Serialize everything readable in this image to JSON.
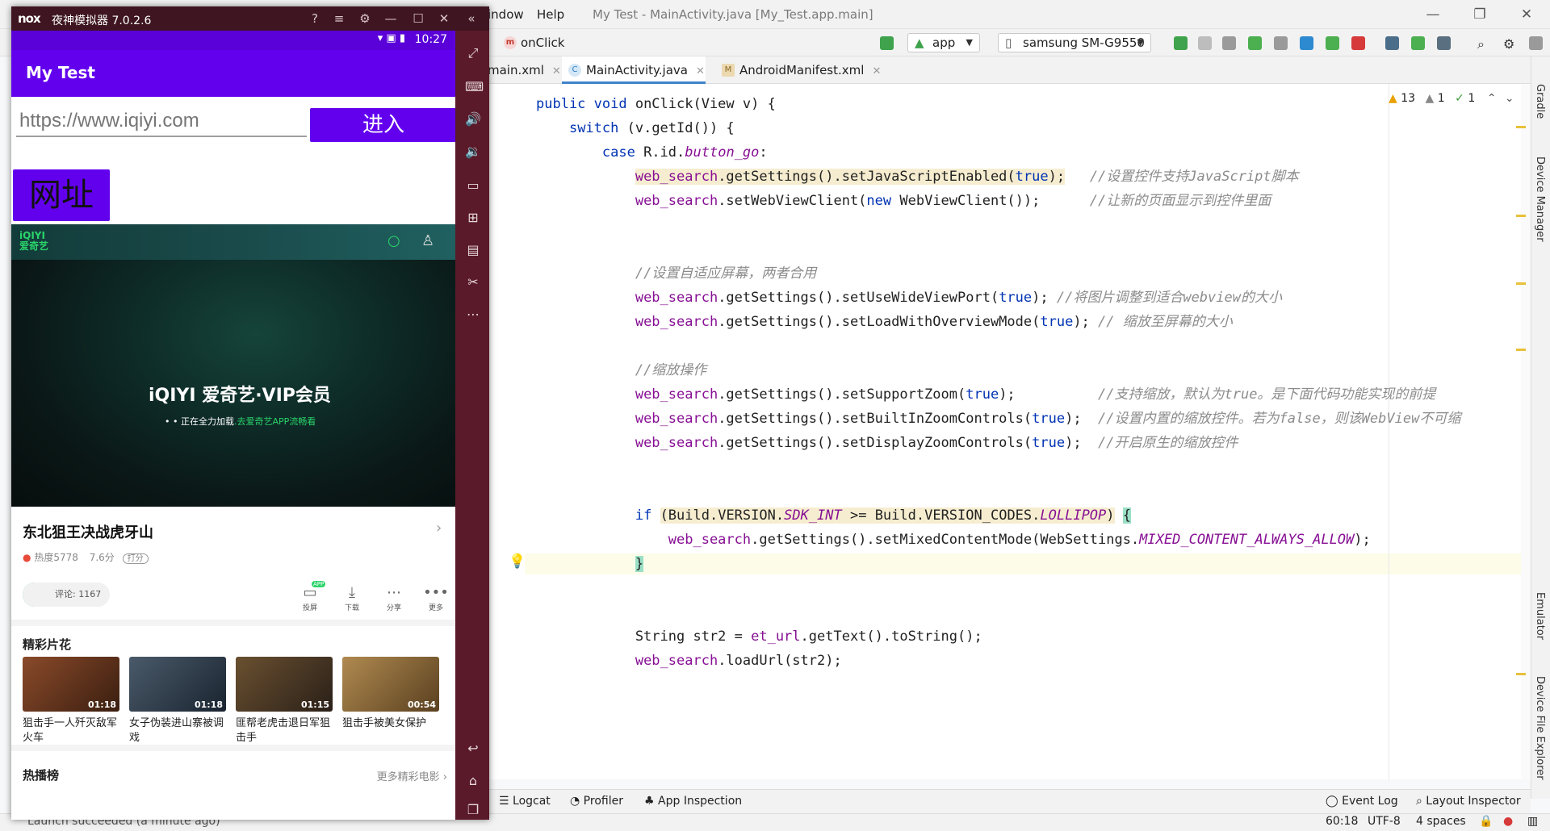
{
  "ide": {
    "menu": [
      "indow",
      "Help"
    ],
    "title": "My Test - MainActivity.java [My_Test.app.main]",
    "breadcrumb": "onClick",
    "breadcrumb_icon": "m",
    "run_config": "app",
    "device": "samsung SM-G9550",
    "tabs": [
      {
        "label": "main.xml",
        "active": false
      },
      {
        "label": "MainActivity.java",
        "active": true
      },
      {
        "label": "AndroidManifest.xml",
        "active": false
      }
    ],
    "inspection": {
      "warnings": "13",
      "weak_warnings": "1",
      "typos": "1"
    },
    "code": [
      "public void onClick(View v) {",
      "    switch (v.getId()) {",
      "        case R.id.button_go:",
      "            web_search.getSettings().setJavaScriptEnabled(true);   //设置控件支持JavaScript脚本",
      "            web_search.setWebViewClient(new WebViewClient());      //让新的页面显示到控件里面",
      "",
      "",
      "            //设置自适应屏幕，两者合用",
      "            web_search.getSettings().setUseWideViewPort(true); //将图片调整到适合webview的大小",
      "            web_search.getSettings().setLoadWithOverviewMode(true); // 缩放至屏幕的大小",
      "",
      "            //缩放操作",
      "            web_search.getSettings().setSupportZoom(true);          //支持缩放，默认为true。是下面代码功能实现的前提",
      "            web_search.getSettings().setBuiltInZoomControls(true);  //设置内置的缩放控件。若为false，则该WebView不可缩",
      "            web_search.getSettings().setDisplayZoomControls(true);  //开启原生的缩放控件",
      "",
      "",
      "            if (Build.VERSION.SDK_INT >= Build.VERSION_CODES.LOLLIPOP) {",
      "                web_search.getSettings().setMixedContentMode(WebSettings.MIXED_CONTENT_ALWAYS_ALLOW);",
      "            }",
      "",
      "",
      "            String str2 = et_url.getText().toString();",
      "            web_search.loadUrl(str2);"
    ],
    "right_tools": [
      "Gradle",
      "Device Manager",
      "Emulator",
      "Device File Explorer"
    ],
    "bottom_tools": [
      "Logcat",
      "Profiler",
      "App Inspection",
      "Event Log",
      "Layout Inspector"
    ],
    "status": {
      "message": "Launch succeeded (a minute ago)",
      "position": "60:18",
      "encoding": "UTF-8",
      "indent": "4 spaces"
    }
  },
  "emulator": {
    "brand": "nox",
    "title": "夜神模拟器 7.0.2.6",
    "time": "10:27",
    "app_title": "My Test",
    "url_placeholder": "https://www.iqiyi.com",
    "go_label": "进入",
    "url_button_label": "网址",
    "iqiyi_logo": "iQIYI\n爱奇艺",
    "vip_logo": "iQIYI 爱奇艺·VIP会员",
    "loading_prefix": "• • 正在全力加载",
    "loading_link": ".去爱奇艺APP流畅看",
    "video_title": "东北狙王决战虎牙山",
    "heat": "热度5778",
    "score": "7.6分",
    "rate_label": "打分",
    "comments": "评论: 1167",
    "actions": [
      {
        "icon": "▭",
        "label": "投屏",
        "badge": "APP"
      },
      {
        "icon": "⤓",
        "label": "下载"
      },
      {
        "icon": "⋯",
        "label": "分享"
      },
      {
        "icon": "•••",
        "label": "更多"
      }
    ],
    "highlights_title": "精彩片花",
    "clips": [
      {
        "duration": "01:18",
        "caption": "狙击手一人歼灭敌军火车",
        "color": "#6b3a22"
      },
      {
        "duration": "01:18",
        "caption": "女子伪装进山寨被调戏",
        "color": "#2a3a4a"
      },
      {
        "duration": "01:15",
        "caption": "匪帮老虎击退日军狙击手",
        "color": "#4a3a28"
      },
      {
        "duration": "00:54",
        "caption": "狙击手被美女保护",
        "color": "#8a6a3a"
      }
    ],
    "hot_title": "热播榜",
    "more_link": "更多精彩电影 ›"
  },
  "colors": {
    "accent": "#6200ee",
    "iqiyi_green": "#2ad46a",
    "emu_frame": "#5a1a2a",
    "keyword": "#0033b3",
    "field": "#871094"
  }
}
